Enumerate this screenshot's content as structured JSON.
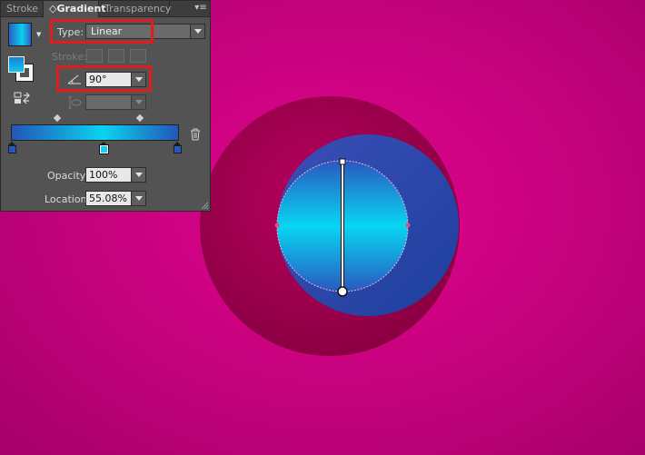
{
  "panel": {
    "tabs": [
      {
        "label": "Stroke",
        "active": false
      },
      {
        "label": "Gradient",
        "active": true,
        "prefix": "◇"
      },
      {
        "label": "Transparency",
        "active": false
      }
    ],
    "menu_icon": "panel-menu-icon",
    "type": {
      "label": "Type:",
      "value": "Linear"
    },
    "stroke": {
      "label": "Stroke:"
    },
    "angle": {
      "value": "90°",
      "icon": "angle-icon"
    },
    "aspect": {
      "value": "",
      "icon": "aspect-ratio-icon"
    },
    "gradient": {
      "stops": [
        {
          "location": 0,
          "color": "#2559bc"
        },
        {
          "location": 55.08,
          "color": "#0bd3f0",
          "selected": true
        },
        {
          "location": 100,
          "color": "#2559bc"
        }
      ],
      "midpoints": [
        27,
        78
      ]
    },
    "opacity": {
      "label": "Opacity:",
      "value": "100%"
    },
    "location": {
      "label": "Location:",
      "value": "55.08%"
    }
  },
  "colors": {
    "canvas_bg": "#d6038a",
    "highlight": "#e21b1b",
    "gradient_blue": "#2559bc",
    "gradient_cyan": "#0bd3f0"
  }
}
